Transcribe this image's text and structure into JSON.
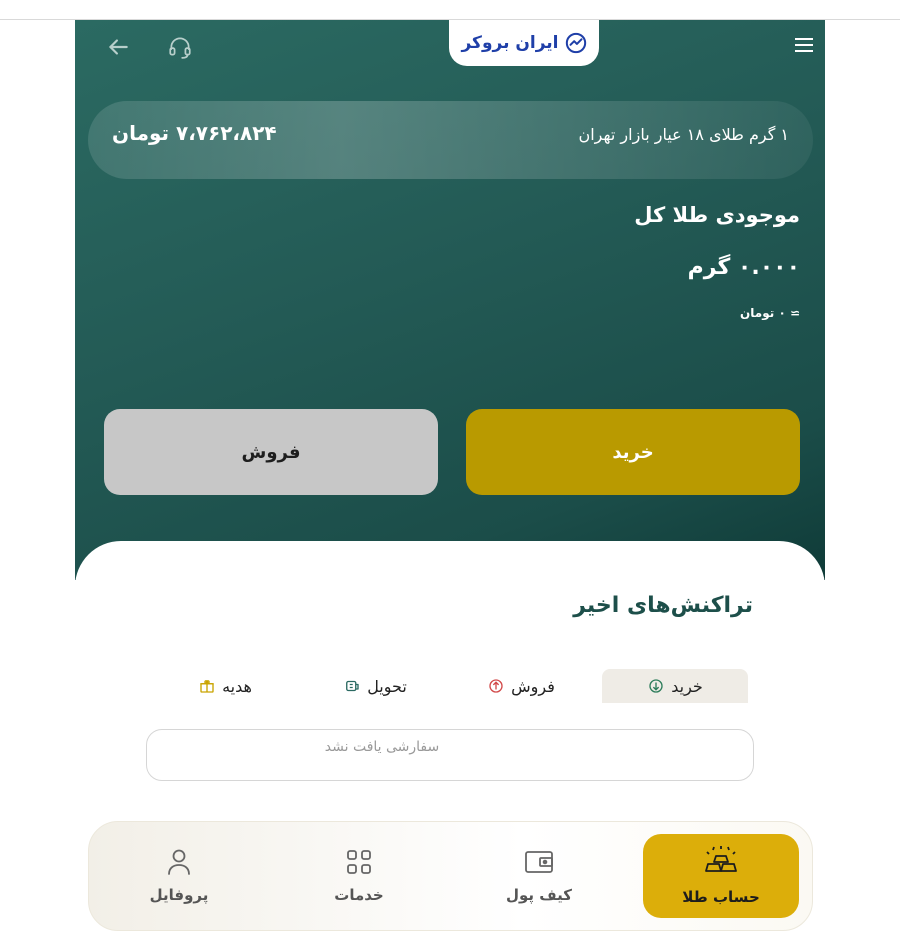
{
  "header": {
    "brand": "ایران بروکر",
    "back_icon": "arrow-left-icon",
    "support_icon": "headset-icon",
    "menu_icon": "hamburger-menu-icon"
  },
  "price": {
    "label": "۱ گرم طلای ۱۸ عیار بازار تهران",
    "value": "۷،۷۶۲،۸۲۴ تومان"
  },
  "balance": {
    "title": "موجودی طلا کل",
    "value": "۰.۰۰۰ گرم",
    "approx": "≃ ۰ تومان"
  },
  "actions": {
    "buy_label": "خرید",
    "sell_label": "فروش"
  },
  "transactions": {
    "title": "تراکنش‌های اخیر",
    "tabs": [
      {
        "label": "خرید",
        "icon": "buy-coin-icon",
        "active": true
      },
      {
        "label": "فروش",
        "icon": "sell-coin-icon",
        "active": false
      },
      {
        "label": "تحویل",
        "icon": "delivery-icon",
        "active": false
      },
      {
        "label": "هدیه",
        "icon": "gift-icon",
        "active": false
      }
    ],
    "empty_text": "سفارشی یافت نشد"
  },
  "nav": {
    "items": [
      {
        "label": "حساب طلا",
        "icon": "gold-bars-icon",
        "active": true
      },
      {
        "label": "کیف پول",
        "icon": "wallet-icon",
        "active": false
      },
      {
        "label": "خدمات",
        "icon": "grid-icon",
        "active": false
      },
      {
        "label": "پروفایل",
        "icon": "user-icon",
        "active": false
      }
    ]
  },
  "colors": {
    "hero_dark": "#1b4d49",
    "buy": "#b99a00",
    "sell": "#c7c7c7",
    "nav_active": "#dcae0a",
    "title_green": "#1d4f4a",
    "brand_blue": "#1f3fa8"
  }
}
